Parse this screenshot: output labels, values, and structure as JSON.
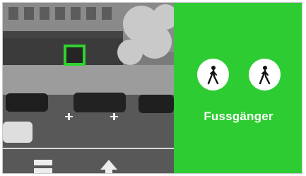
{
  "detection": {
    "category_label": "Fussgänger",
    "accent_color": "#2ecc33",
    "box_color": "#2fd22f",
    "icons": [
      "pedestrian-icon",
      "pedestrian-icon"
    ]
  }
}
